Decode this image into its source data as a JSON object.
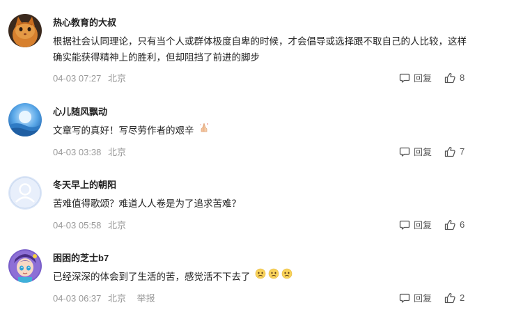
{
  "comments": [
    {
      "username": "热心教育的大叔",
      "text": "根据社会认同理论，只有当个人或群体极度自卑的时候，才会倡导或选择跟不取自己的人比较，这样确实能获得精神上的胜利，但却阻挡了前进的脚步",
      "date": "04-03 07:27",
      "location": "北京",
      "reply_label": "回复",
      "likes": "8",
      "avatar": "orange-cat-avatar"
    },
    {
      "username": "心儿随风飘动",
      "text": "文章写的真好！写尽劳作者的艰辛",
      "date": "04-03 03:38",
      "location": "北京",
      "reply_label": "回复",
      "likes": "7",
      "avatar": "blue-moon-avatar"
    },
    {
      "username": "冬天早上的朝阳",
      "text": "苦难值得歌颂？难道人人卷是为了追求苦难？",
      "date": "04-03 05:58",
      "location": "北京",
      "reply_label": "回复",
      "likes": "6",
      "avatar": "default-user-avatar"
    },
    {
      "username": "困困的芝士b7",
      "text": "已经深深的体会到了生活的苦，感觉活不下去了",
      "date": "04-03 06:37",
      "location": "北京",
      "report_label": "举报",
      "reply_label": "回复",
      "likes": "2",
      "avatar": "cartoon-character-avatar"
    }
  ],
  "colors": {
    "text": "#222222",
    "meta": "#999999",
    "action": "#555555"
  }
}
